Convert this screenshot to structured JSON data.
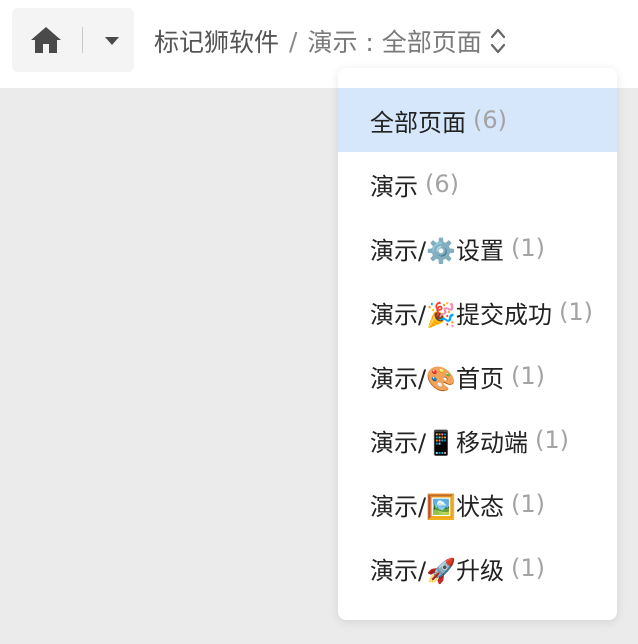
{
  "header": {
    "home_icon": "home-icon",
    "dropdown_icon": "caret-down-icon",
    "app_name": "标记狮软件",
    "separator": "/",
    "current": "演示 : 全部页面",
    "sort_icon": "sort-updown-icon"
  },
  "dropdown": {
    "items": [
      {
        "label": "全部页面",
        "count": "(6)",
        "selected": true
      },
      {
        "label": "演示",
        "count": "(6)"
      },
      {
        "label": "演示/⚙️设置",
        "count": "(1)"
      },
      {
        "label": "演示/🎉提交成功",
        "count": "(1)"
      },
      {
        "label": "演示/🎨首页",
        "count": "(1)"
      },
      {
        "label": "演示/📱移动端",
        "count": "(1)"
      },
      {
        "label": "演示/🖼️状态",
        "count": "(1)"
      },
      {
        "label": "演示/🚀升级",
        "count": "(1)"
      }
    ]
  },
  "colors": {
    "selected_bg": "#d6e7fb",
    "page_bg": "#ebebeb",
    "count_text": "#a3a3a3"
  }
}
